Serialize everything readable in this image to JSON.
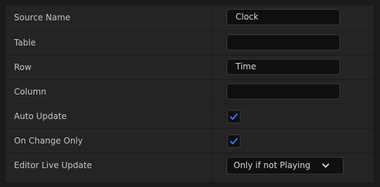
{
  "details": {
    "rows": [
      {
        "label": "Source Name",
        "type": "text",
        "value": "Clock"
      },
      {
        "label": "Table",
        "type": "text",
        "value": ""
      },
      {
        "label": "Row",
        "type": "text",
        "value": "Time"
      },
      {
        "label": "Column",
        "type": "text",
        "value": ""
      },
      {
        "label": "Auto Update",
        "type": "checkbox",
        "checked": true
      },
      {
        "label": "On Change Only",
        "type": "checkbox",
        "checked": true
      },
      {
        "label": "Editor Live Update",
        "type": "dropdown",
        "value": "Only if not Playing"
      }
    ]
  },
  "icons": {
    "checkmark": "checkmark-icon",
    "dropdown": "chevron-down-icon"
  },
  "colors": {
    "panel_bg": "#242424",
    "field_bg": "#0f0f0f",
    "check_accent": "#2f80ff"
  }
}
